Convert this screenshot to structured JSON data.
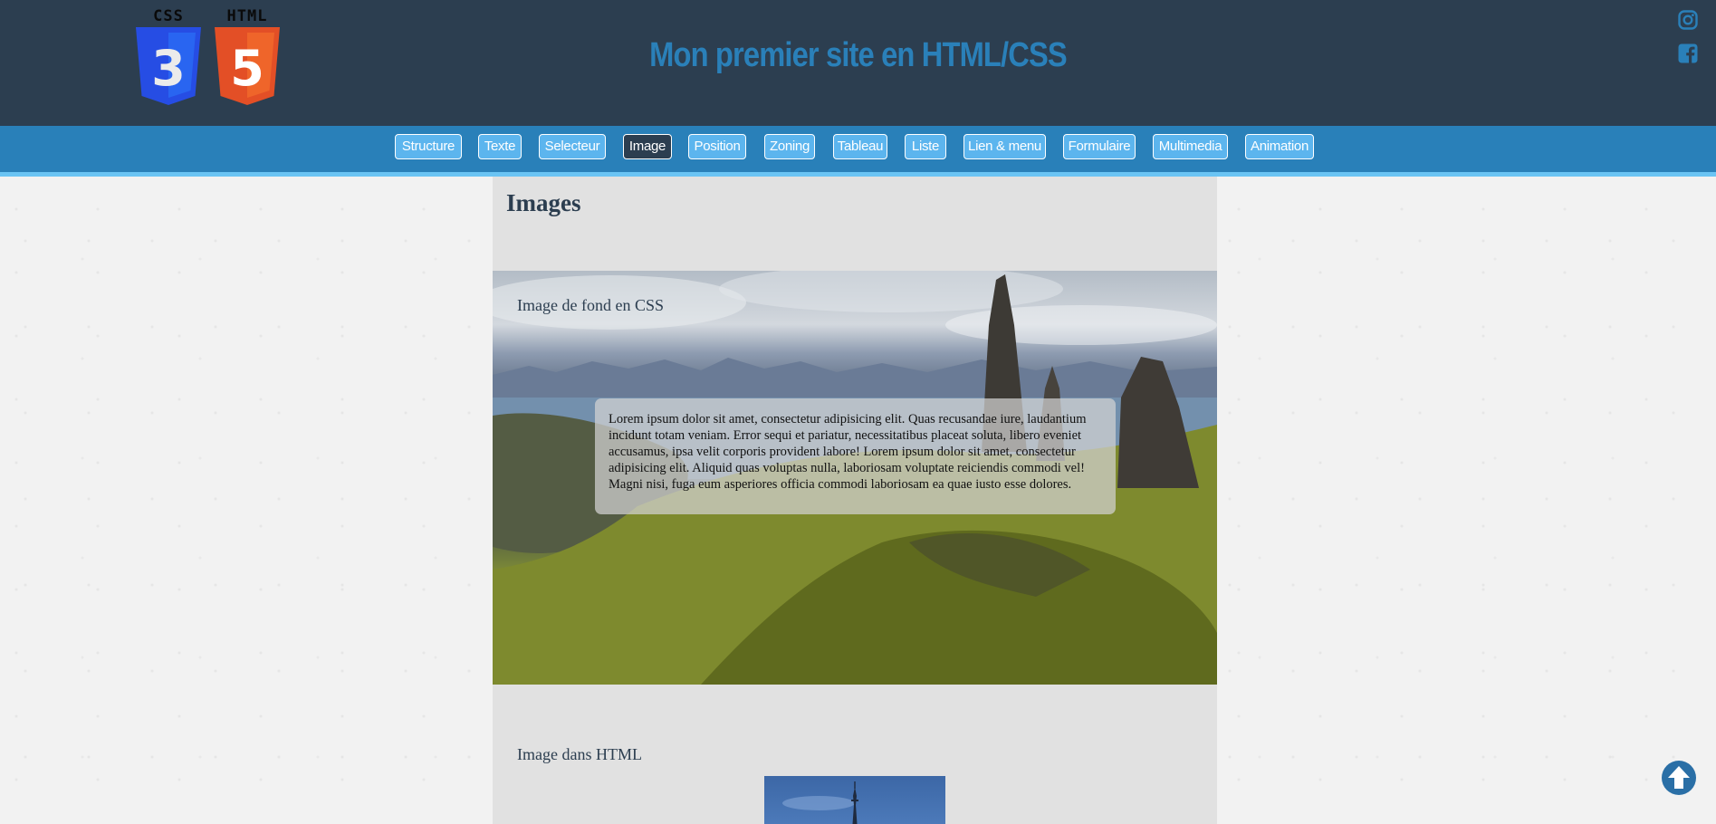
{
  "header": {
    "logo_css_label": "CSS",
    "logo_css_number": "3",
    "logo_html_label": "HTML",
    "logo_html_number": "5",
    "site_title": "Mon premier site en HTML/CSS",
    "social": [
      "instagram-icon",
      "facebook-icon"
    ]
  },
  "nav": {
    "items": [
      {
        "label": "Structure",
        "active": false
      },
      {
        "label": "Texte",
        "active": false
      },
      {
        "label": "Selecteur",
        "active": false
      },
      {
        "label": "Image",
        "active": true
      },
      {
        "label": "Position",
        "active": false
      },
      {
        "label": "Zoning",
        "active": false
      },
      {
        "label": "Tableau",
        "active": false
      },
      {
        "label": "Liste",
        "active": false
      },
      {
        "label": "Lien & menu",
        "active": false
      },
      {
        "label": "Formulaire",
        "active": false
      },
      {
        "label": "Multimedia",
        "active": false
      },
      {
        "label": "Animation",
        "active": false
      }
    ]
  },
  "main": {
    "heading": "Images",
    "bg_section": {
      "title": "Image de fond en CSS",
      "overlay_text": "Lorem ipsum dolor sit amet, consectetur adipisicing elit. Quas recusandae iure, laudantium incidunt totam veniam. Error sequi et pariatur, necessitatibus placeat soluta, libero eveniet accusamus, ipsa velit corporis provident labore! Lorem ipsum dolor sit amet, consectetur adipisicing elit. Aliquid quas voluptas nulla, laboriosam voluptate reiciendis commodi vel! Magni nisi, fuga eum asperiores officia commodi laboriosam ea quae iusto esse dolores."
    },
    "html_section": {
      "title": "Image dans HTML"
    }
  },
  "scroll_top": "arrow-up-circle-icon",
  "colors": {
    "header_bg": "#2c3e50",
    "nav_bg": "#2980b9",
    "nav_btn": "#5cb5ee",
    "nav_active": "#2c3e50",
    "title": "#2a80b9",
    "content_bg": "#e1e1e1"
  }
}
